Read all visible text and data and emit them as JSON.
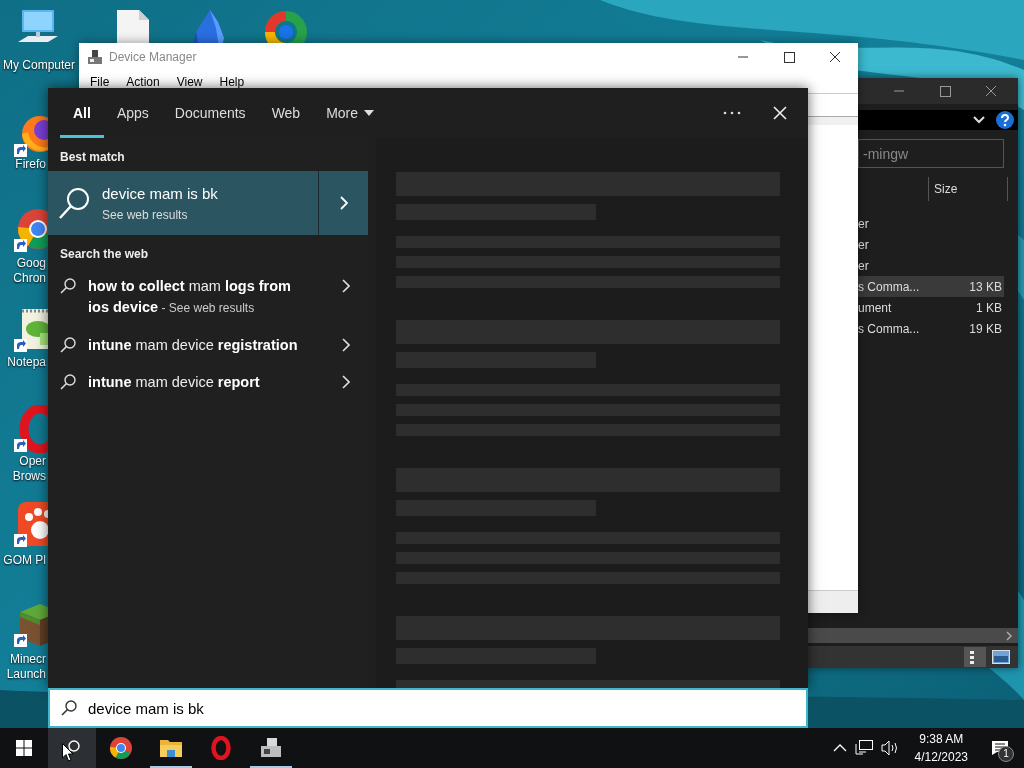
{
  "desktop_icons": [
    {
      "label": [
        "My Computer"
      ]
    },
    {
      "label": [
        "Firefo"
      ]
    },
    {
      "label": [
        "Goog",
        "Chron"
      ]
    },
    {
      "label": [
        "Notepa"
      ]
    },
    {
      "label": [
        "Oper",
        "Brows"
      ]
    },
    {
      "label": [
        "GOM Pl"
      ]
    },
    {
      "label": [
        "Minecr",
        "Launch"
      ]
    }
  ],
  "device_manager": {
    "title": "Device Manager",
    "menu": [
      "File",
      "Action",
      "View",
      "Help"
    ]
  },
  "explorer": {
    "search_placeholder": "-mingw",
    "columns": [
      {
        "label": "Size"
      }
    ],
    "rows": [
      {
        "name": "er",
        "selected": false
      },
      {
        "name": "er",
        "selected": false
      },
      {
        "name": "er",
        "selected": false
      },
      {
        "name": "s Comma...",
        "size": "13 KB",
        "selected": true
      },
      {
        "name": "ument",
        "size": "1 KB",
        "selected": false
      },
      {
        "name": "s Comma...",
        "size": "19 KB",
        "selected": false
      }
    ]
  },
  "search_panel": {
    "tabs": [
      {
        "label": "All",
        "selected": true
      },
      {
        "label": "Apps",
        "selected": false
      },
      {
        "label": "Documents",
        "selected": false
      },
      {
        "label": "Web",
        "selected": false
      },
      {
        "label": "More",
        "selected": false,
        "dropdown": true
      }
    ],
    "best_match": {
      "heading": "Best match",
      "title": "device mam is bk",
      "subtitle": "See web results",
      "selected": true
    },
    "web": {
      "heading": "Search the web",
      "suggestions": [
        {
          "text": "**how to collect** mam **logs from ios device**",
          "suffix": "- See web results"
        },
        {
          "text": "**intune** mam device **registration**"
        },
        {
          "text": "**intune** mam device **report**"
        }
      ]
    },
    "query": "device mam is bk"
  },
  "taskbar": {
    "search_selected": true,
    "apps": [
      {
        "running": false
      },
      {
        "running": true
      },
      {
        "running": false
      },
      {
        "running": true
      }
    ],
    "time": "9:38 AM",
    "date": "4/12/2023",
    "notification_count": "1"
  }
}
